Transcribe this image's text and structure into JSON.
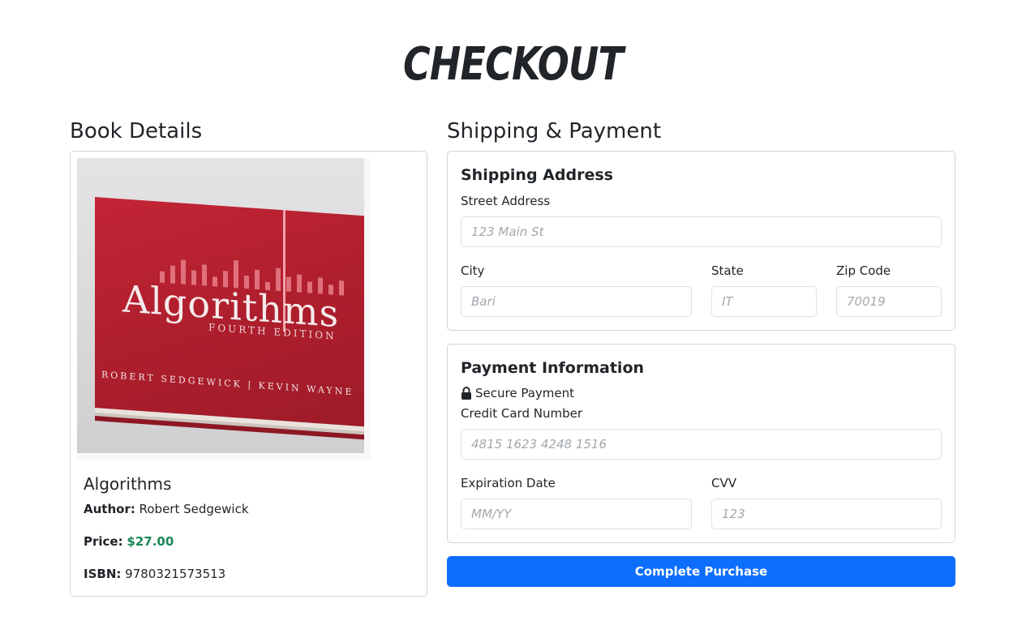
{
  "page": {
    "title": "CHECKOUT"
  },
  "book_section": {
    "heading": "Book Details",
    "cover": {
      "title": "Algorithms",
      "edition": "FOURTH EDITION",
      "authors": "ROBERT SEDGEWICK | KEVIN WAYNE"
    },
    "title": "Algorithms",
    "author_label": "Author:",
    "author": "Robert Sedgewick",
    "price_label": "Price:",
    "price": "$27.00",
    "isbn_label": "ISBN:",
    "isbn": "9780321573513"
  },
  "shipping_payment": {
    "heading": "Shipping & Payment",
    "shipping": {
      "heading": "Shipping Address",
      "street_label": "Street Address",
      "street_placeholder": "123 Main St",
      "city_label": "City",
      "city_placeholder": "Bari",
      "state_label": "State",
      "state_placeholder": "IT",
      "zip_label": "Zip Code",
      "zip_placeholder": "70019"
    },
    "payment": {
      "heading": "Payment Information",
      "secure_text": "Secure Payment",
      "card_label": "Credit Card Number",
      "card_placeholder": "4815 1623 4248 1516",
      "exp_label": "Expiration Date",
      "exp_placeholder": "MM/YY",
      "cvv_label": "CVV",
      "cvv_placeholder": "123"
    },
    "submit_label": "Complete Purchase"
  },
  "colors": {
    "primary": "#0d6efd",
    "price": "#198754",
    "border": "#ced4da"
  },
  "icons": {
    "secure": "lock-icon"
  }
}
